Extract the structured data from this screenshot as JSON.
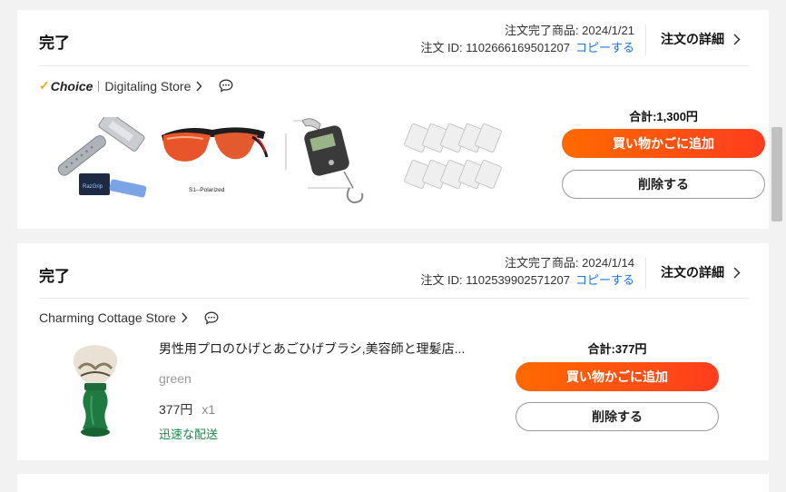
{
  "orders": [
    {
      "status": "完了",
      "order_date": "注文完了商品: 2024/1/21",
      "order_id": "注文 ID: 1102666169501207",
      "copy_label": "コピーする",
      "detail_label": "注文の詳細",
      "choice_label": "Choice",
      "store_name": "Digitaling Store",
      "total": "合計:1,300円",
      "cart_label": "買い物かごに追加",
      "delete_label": "削除する",
      "products": [
        {
          "icon": "razor-image"
        },
        {
          "icon": "sunglasses-image",
          "caption": "S1--Polarized"
        },
        {
          "icon": "luggage-scale-image"
        },
        {
          "icon": "razor-blades-image"
        }
      ]
    },
    {
      "status": "完了",
      "order_date": "注文完了商品: 2024/1/14",
      "order_id": "注文 ID: 1102539902571207",
      "copy_label": "コピーする",
      "detail_label": "注文の詳細",
      "store_name": "Charming Cottage Store",
      "product_name": "男性用プロのひげとあごひげブラシ,美容師と理髪店...",
      "variant": "green",
      "price": "377円",
      "qty": "x1",
      "shipping": "迅速な配送",
      "total": "合計:377円",
      "cart_label": "買い物かごに追加",
      "delete_label": "削除する",
      "product_icon": "shaving-brush-image"
    }
  ],
  "colors": {
    "accent": "#ff4d16",
    "link": "#1a73e8",
    "shipping": "#1a8a4a"
  }
}
